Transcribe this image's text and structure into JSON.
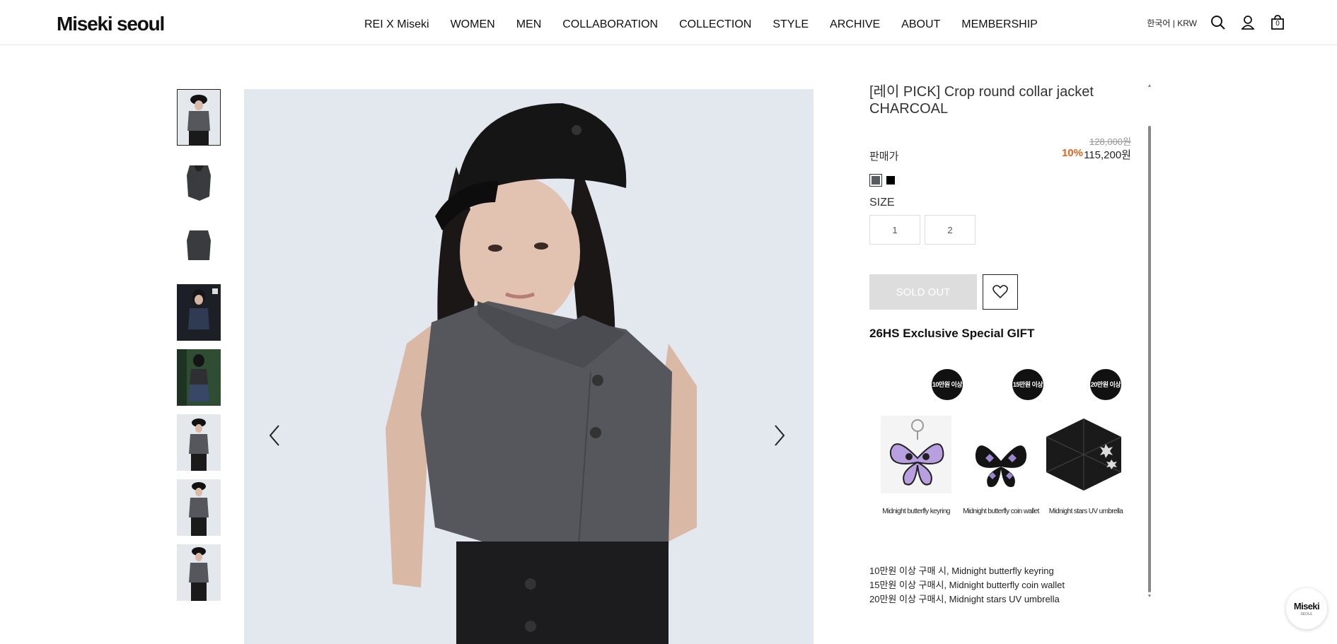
{
  "header": {
    "logo": "Miseki seoul",
    "nav": [
      "REI X Miseki",
      "WOMEN",
      "MEN",
      "COLLABORATION",
      "COLLECTION",
      "STYLE",
      "ARCHIVE",
      "ABOUT",
      "MEMBERSHIP"
    ],
    "lang": "한국어 | KRW",
    "icons": [
      "search-icon",
      "account-icon",
      "cart-icon"
    ],
    "cart_count": "0"
  },
  "gallery": {
    "thumbnail_count": 8,
    "arrows": [
      "chevron-left-icon",
      "chevron-right-icon"
    ]
  },
  "product": {
    "title": "[레이 PICK] Crop round collar jacket CHARCOAL",
    "price_label": "판매가",
    "original_price": "128,000원",
    "discount": "10%",
    "sale_price": "115,200원",
    "colors": [
      "#5a5c63",
      "#000000"
    ],
    "size_label": "SIZE",
    "sizes": [
      "1",
      "2"
    ],
    "soldout_label": "SOLD OUT",
    "wishlist_icon": "heart-icon"
  },
  "gift": {
    "title": "26HS Exclusive Special GIFT",
    "items": [
      {
        "badge": "10만원 이상",
        "caption": "Midnight butterfly keyring"
      },
      {
        "badge": "15만원 이상",
        "caption": "Midnight butterfly coin wallet"
      },
      {
        "badge": "20만원 이상",
        "caption": "Midnight stars UV umbrella"
      }
    ],
    "notes": [
      "10만원 이상 구매 시, Midnight butterfly keyring",
      "15만원 이상 구매시, Midnight butterfly coin wallet",
      "20만원 이상 구매시, Midnight stars UV umbrella"
    ]
  },
  "floating": {
    "line1": "Miseki",
    "line2": "SEOUL"
  },
  "accent": {
    "discount": "#e0651e",
    "soldout_bg": "#dddddd"
  }
}
